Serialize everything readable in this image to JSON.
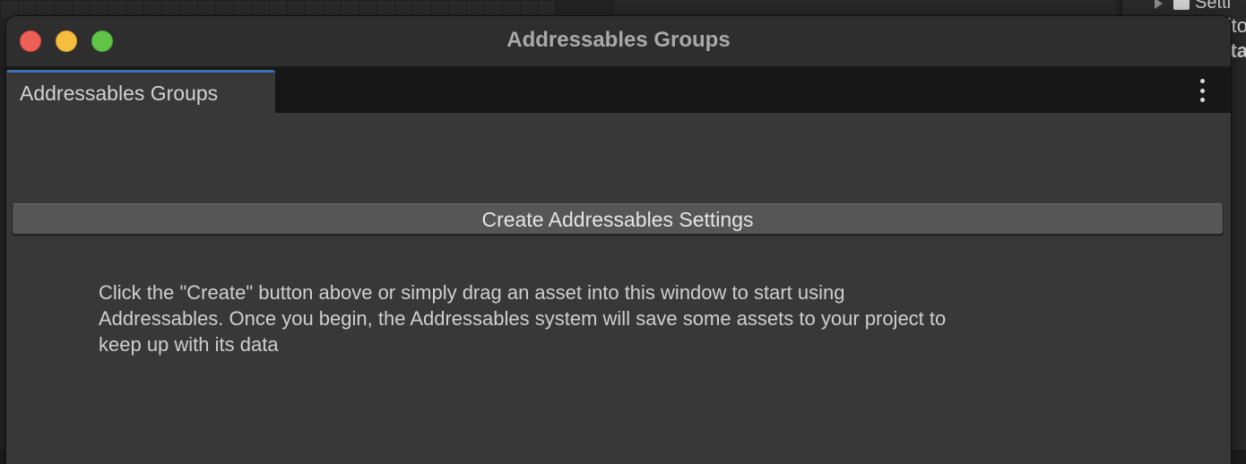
{
  "background": {
    "right_panel": {
      "tree_item_label": "Setti",
      "line2": "ito",
      "line3": "ta"
    }
  },
  "window": {
    "title": "Addressables Groups",
    "traffic_lights": {
      "close_color": "#ee5f57",
      "minimize_color": "#f5be3f",
      "maximize_color": "#5fc447"
    }
  },
  "tabs": [
    {
      "label": "Addressables Groups",
      "active": true
    }
  ],
  "tab_menu_icon": "vertical-ellipsis-icon",
  "main": {
    "create_button_label": "Create Addressables Settings",
    "help_text": "Click the \"Create\" button above or simply drag an asset into this window to start using\nAddressables.  Once you begin, the Addressables system will save some assets to your project to\nkeep up with its data"
  },
  "colors": {
    "accent_tab": "#3a6fb0",
    "window_bg": "#383838",
    "button_bg": "#565656"
  }
}
